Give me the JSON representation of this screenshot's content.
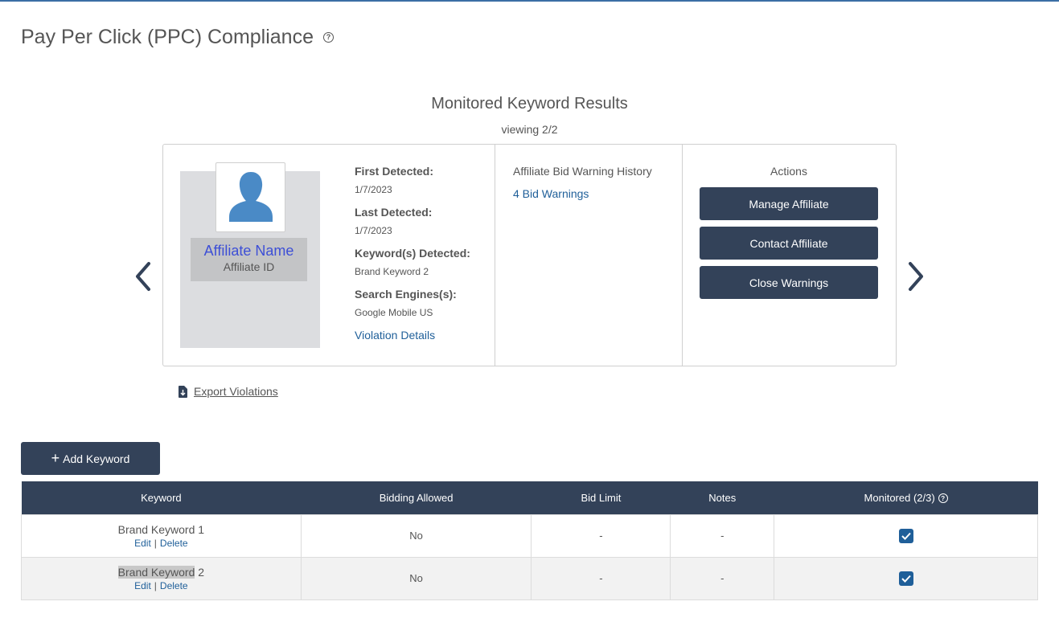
{
  "page": {
    "title": "Pay Per Click (PPC) Compliance"
  },
  "results": {
    "title": "Monitored Keyword Results",
    "viewing": "viewing 2/2"
  },
  "affiliate": {
    "name": "Affiliate Name",
    "id": "Affiliate ID"
  },
  "details": {
    "first_detected_label": "First Detected:",
    "first_detected_value": "1/7/2023",
    "last_detected_label": "Last Detected:",
    "last_detected_value": "1/7/2023",
    "keywords_label": "Keyword(s) Detected:",
    "keywords_value": "Brand Keyword 2",
    "engines_label": "Search Engines(s):",
    "engines_value": "Google Mobile US",
    "violation_link": "Violation Details"
  },
  "warnings": {
    "title": "Affiliate Bid Warning History",
    "link": "4 Bid Warnings"
  },
  "actions": {
    "title": "Actions",
    "manage": "Manage Affiliate",
    "contact": "Contact Affiliate",
    "close": "Close Warnings"
  },
  "export": {
    "label": "Export Violations"
  },
  "add_keyword": {
    "label": "Add Keyword"
  },
  "table": {
    "headers": {
      "keyword": "Keyword",
      "bidding": "Bidding Allowed",
      "bid_limit": "Bid Limit",
      "notes": "Notes",
      "monitored": "Monitored (2/3)"
    },
    "edit_label": "Edit",
    "delete_label": "Delete",
    "rows": [
      {
        "keyword": "Brand Keyword 1",
        "bidding": "No",
        "bid_limit": "-",
        "notes": "-",
        "monitored": true
      },
      {
        "keyword_highlight": "Brand Keyword",
        "keyword_rest": " 2",
        "bidding": "No",
        "bid_limit": "-",
        "notes": "-",
        "monitored": true
      }
    ]
  },
  "colors": {
    "primary": "#334259",
    "link": "#1f5f99",
    "affiliate_name": "#3d4fd6",
    "avatar": "#4a8ac6"
  }
}
